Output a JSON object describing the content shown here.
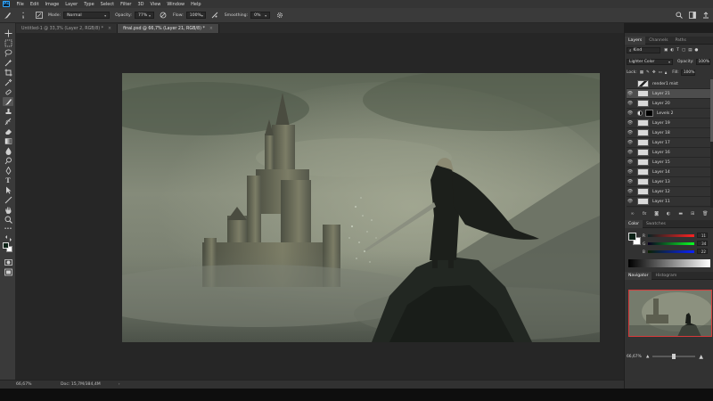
{
  "menu": {
    "logo": "Ps",
    "items": [
      "File",
      "Edit",
      "Image",
      "Layer",
      "Type",
      "Select",
      "Filter",
      "3D",
      "View",
      "Window",
      "Help"
    ]
  },
  "options": {
    "brush_size": "9",
    "mode_label": "Mode:",
    "mode_value": "Normal",
    "opacity_label": "Opacity:",
    "opacity_value": "77%",
    "flow_label": "Flow:",
    "flow_value": "100%",
    "smoothing_label": "Smoothing:",
    "smoothing_value": "0%"
  },
  "tabs": [
    {
      "label": "Untitled-1 @ 33,3% (Layer 2, RGB/8) *"
    },
    {
      "label": "final.psd @ 66,7% (Layer 21, RGB/8) *"
    }
  ],
  "status": {
    "zoom": "66,67%",
    "doc": "Doc: 15,7M/384,4M"
  },
  "layers_panel": {
    "tabs": [
      "Layers",
      "Channels",
      "Paths"
    ],
    "kind_label": "Kind",
    "blend_mode": "Lighter Color",
    "opacity_label": "Opacity:",
    "opacity_value": "100%",
    "lock_label": "Lock:",
    "fill_label": "Fill:",
    "fill_value": "100%",
    "layers": [
      {
        "name": "render1 mist",
        "visible": false,
        "selected": false,
        "type": "thumb-dark"
      },
      {
        "name": "Layer 21",
        "visible": true,
        "selected": true,
        "type": "thumb"
      },
      {
        "name": "Layer 20",
        "visible": true,
        "selected": false,
        "type": "thumb"
      },
      {
        "name": "Levels 2",
        "visible": true,
        "selected": false,
        "type": "adjustment"
      },
      {
        "name": "Layer 19",
        "visible": true,
        "selected": false,
        "type": "thumb"
      },
      {
        "name": "Layer 18",
        "visible": true,
        "selected": false,
        "type": "thumb"
      },
      {
        "name": "Layer 17",
        "visible": true,
        "selected": false,
        "type": "thumb"
      },
      {
        "name": "Layer 16",
        "visible": true,
        "selected": false,
        "type": "thumb"
      },
      {
        "name": "Layer 15",
        "visible": true,
        "selected": false,
        "type": "thumb"
      },
      {
        "name": "Layer 14",
        "visible": true,
        "selected": false,
        "type": "thumb"
      },
      {
        "name": "Layer 13",
        "visible": true,
        "selected": false,
        "type": "thumb"
      },
      {
        "name": "Layer 12",
        "visible": true,
        "selected": false,
        "type": "thumb"
      },
      {
        "name": "Layer 11",
        "visible": true,
        "selected": false,
        "type": "thumb"
      }
    ]
  },
  "color_panel": {
    "tabs": [
      "Color",
      "Swatches"
    ],
    "sliders": [
      {
        "label": "R",
        "value": "11",
        "gradient": "linear-gradient(90deg,#0b2222,#ff2222)"
      },
      {
        "label": "G",
        "value": "34",
        "gradient": "linear-gradient(90deg,#0b0022,#0bff22)"
      },
      {
        "label": "B",
        "value": "22",
        "gradient": "linear-gradient(90deg,#0b2200,#0b22ff)"
      }
    ],
    "foreground": "#0b2216",
    "background": "#ffffff"
  },
  "navigator_panel": {
    "tabs": [
      "Navigator",
      "Histogram"
    ],
    "zoom": "66,67%"
  }
}
